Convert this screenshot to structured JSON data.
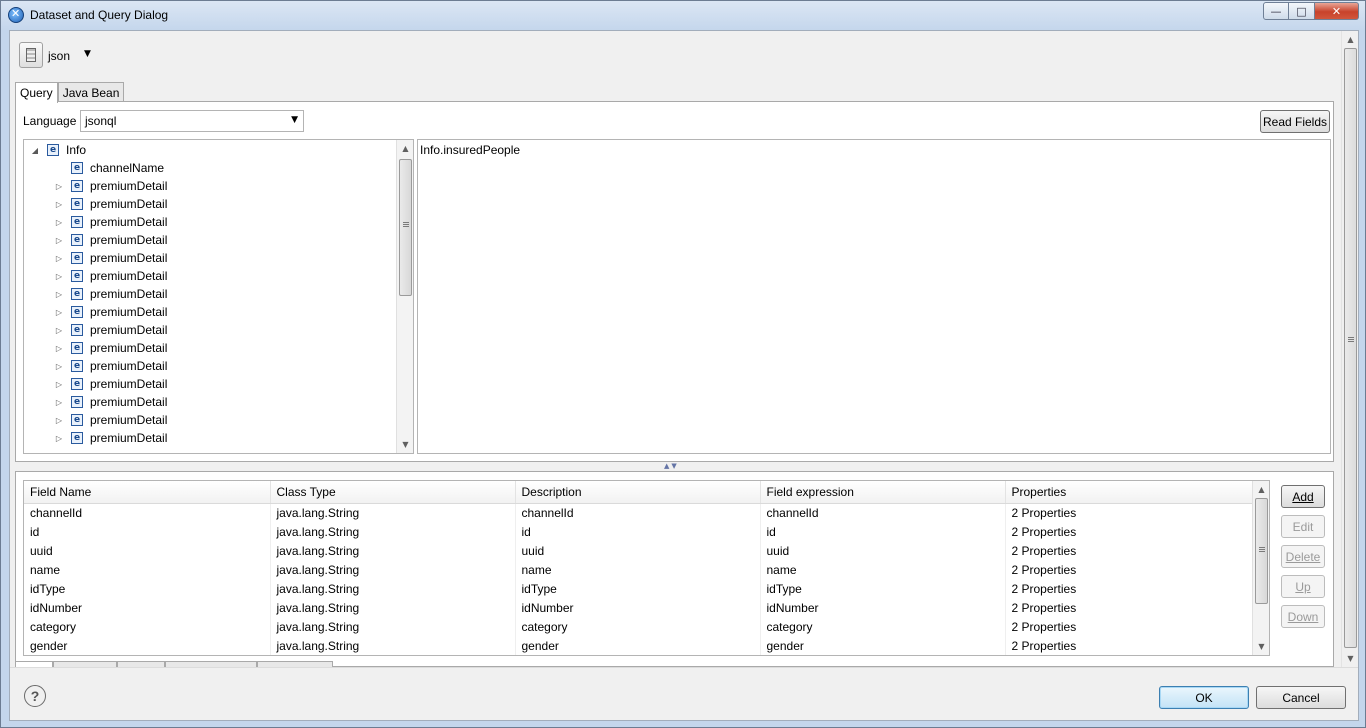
{
  "window": {
    "title": "Dataset and Query Dialog"
  },
  "datasource": {
    "label": "json"
  },
  "top_tabs": [
    {
      "label": "Query"
    },
    {
      "label": "Java Bean"
    }
  ],
  "language": {
    "label": "Language",
    "value": "jsonql"
  },
  "read_fields_label": "Read Fields",
  "tree": {
    "root": "Info",
    "items": [
      "channelName",
      "premiumDetail",
      "premiumDetail",
      "premiumDetail",
      "premiumDetail",
      "premiumDetail",
      "premiumDetail",
      "premiumDetail",
      "premiumDetail",
      "premiumDetail",
      "premiumDetail",
      "premiumDetail",
      "premiumDetail",
      "premiumDetail",
      "premiumDetail",
      "premiumDetail"
    ]
  },
  "query_text": "Info.insuredPeople",
  "fields_table": {
    "columns": [
      "Field Name",
      "Class Type",
      "Description",
      "Field expression",
      "Properties"
    ],
    "rows": [
      [
        "channelId",
        "java.lang.String",
        "channelId",
        "channelId",
        "2 Properties"
      ],
      [
        "id",
        "java.lang.String",
        "id",
        "id",
        "2 Properties"
      ],
      [
        "uuid",
        "java.lang.String",
        "uuid",
        "uuid",
        "2 Properties"
      ],
      [
        "name",
        "java.lang.String",
        "name",
        "name",
        "2 Properties"
      ],
      [
        "idType",
        "java.lang.String",
        "idType",
        "idType",
        "2 Properties"
      ],
      [
        "idNumber",
        "java.lang.String",
        "idNumber",
        "idNumber",
        "2 Properties"
      ],
      [
        "category",
        "java.lang.String",
        "category",
        "category",
        "2 Properties"
      ],
      [
        "gender",
        "java.lang.String",
        "gender",
        "gender",
        "2 Properties"
      ]
    ]
  },
  "side_buttons": {
    "add": "Add",
    "edit": "Edit",
    "delete": "Delete",
    "up": "Up",
    "down": "Down"
  },
  "footer": {
    "ok": "OK",
    "cancel": "Cancel",
    "help": "?"
  }
}
